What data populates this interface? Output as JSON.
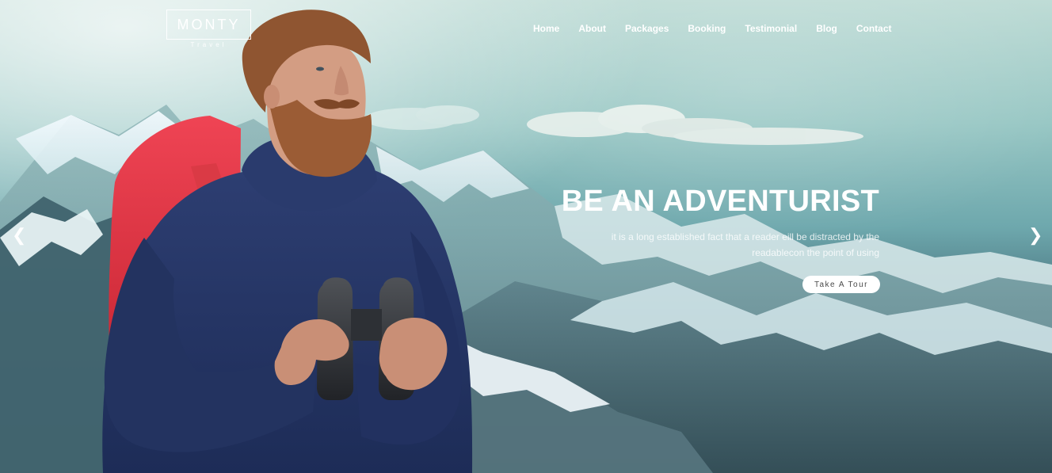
{
  "brand": {
    "name": "MONTY",
    "tagline": "Travel"
  },
  "navigation": {
    "items": [
      {
        "label": "Home"
      },
      {
        "label": "About"
      },
      {
        "label": "Packages"
      },
      {
        "label": "Booking"
      },
      {
        "label": "Testimonial"
      },
      {
        "label": "Blog"
      },
      {
        "label": "Contact"
      }
    ]
  },
  "hero": {
    "title": "BE AN ADVENTURIST",
    "description_line1": "it is a long established fact that a reader eill be distracted by the",
    "description_line2": "readablecon the point of using",
    "cta_label": "Take A Tour"
  },
  "icons": {
    "prev": "chevron-left-icon",
    "next": "chevron-right-icon"
  },
  "colors": {
    "white": "#ffffff",
    "jacket_red": "#d8242e",
    "sweater_navy": "#253566",
    "beard_brown": "#8a5634",
    "mountain_shadow": "#31505b"
  }
}
